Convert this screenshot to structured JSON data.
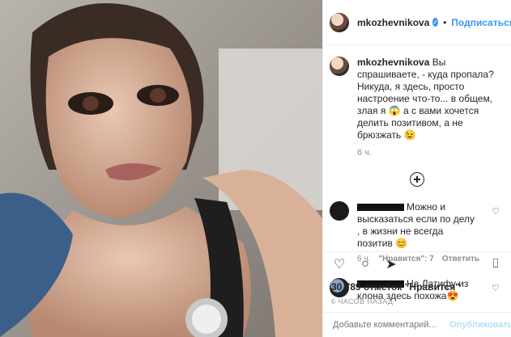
{
  "header": {
    "username": "mkozhevnikova",
    "follow_label": "Подписаться",
    "dot": "•"
  },
  "caption": {
    "username": "mkozhevnikova",
    "text": "Вы спрашиваете, - куда пропала? Никуда, я здесь, просто настроение что-то... в общем, злая я 😱 а с вами хочется делить позитивом, а не брюзжать 😉",
    "time": "6 ч."
  },
  "comments": [
    {
      "text": "Можно и высказаться если по делу , в жизни не всегда позитив 😊",
      "time": "6 ч.",
      "likes": "\"Нравится\": 7",
      "reply": "Ответить"
    },
    {
      "text": "На Латифу из клона здесь похожа😍"
    }
  ],
  "actions": {
    "likes_text": "30 789 отметок \"Нравится\"",
    "posted_ago": "6 ЧАСОВ НАЗАД"
  },
  "add_comment": {
    "placeholder": "Добавьте комментарий...",
    "publish_label": "Опубликовать"
  }
}
